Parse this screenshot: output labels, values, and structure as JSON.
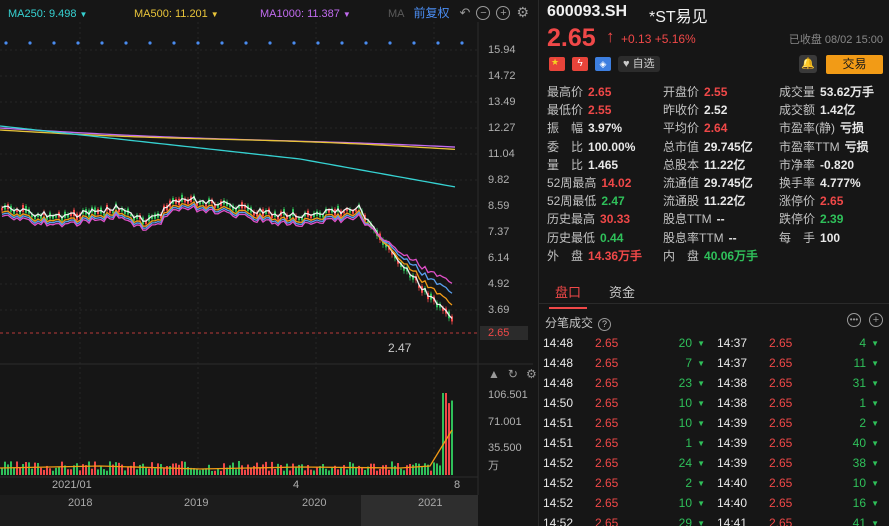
{
  "chart": {
    "ma": [
      {
        "label": "MA250: 9.498",
        "color": "#36d2d2"
      },
      {
        "label": "MA500: 11.201",
        "color": "#e8c43a"
      },
      {
        "label": "MA1000: 11.387",
        "color": "#c26cf0"
      },
      {
        "label": "MA",
        "color": "#5a5a5a"
      }
    ],
    "adjust_label": "前复权",
    "price_axis": [
      "15.94",
      "14.72",
      "13.49",
      "12.27",
      "11.04",
      "9.82",
      "8.59",
      "7.37",
      "6.14",
      "4.92",
      "3.69"
    ],
    "last_price_tag": "2.65",
    "low_label": "2.47",
    "volume_axis": [
      "106.501",
      "71.001",
      "35.500",
      "万"
    ],
    "dates": [
      "2021/01",
      "4",
      "8"
    ],
    "years": [
      "2018",
      "2019",
      "2020",
      "2021"
    ]
  },
  "quote": {
    "code": "600093.SH",
    "name": "*ST易见",
    "price": "2.65",
    "change": "+0.13 +5.16%",
    "status": "已收盘 08/02 15:00",
    "watch_label": "自选",
    "trade_label": "交易"
  },
  "stats": {
    "col1": [
      {
        "k": "最高价",
        "v": "2.65",
        "c": "red"
      },
      {
        "k": "最低价",
        "v": "2.55",
        "c": "red"
      },
      {
        "k": "振　幅",
        "v": "3.97%",
        "c": "white"
      },
      {
        "k": "委　比",
        "v": "100.00%",
        "c": "white"
      },
      {
        "k": "量　比",
        "v": "1.465",
        "c": "white"
      },
      {
        "k": "52周最高",
        "v": "14.02",
        "c": "red"
      },
      {
        "k": "52周最低",
        "v": "2.47",
        "c": "green"
      },
      {
        "k": "历史最高",
        "v": "30.33",
        "c": "red"
      },
      {
        "k": "历史最低",
        "v": "0.44",
        "c": "green"
      },
      {
        "k": "外　盘",
        "v": "14.36万手",
        "c": "red"
      }
    ],
    "col2": [
      {
        "k": "开盘价",
        "v": "2.55",
        "c": "red"
      },
      {
        "k": "昨收价",
        "v": "2.52",
        "c": "white"
      },
      {
        "k": "平均价",
        "v": "2.64",
        "c": "red"
      },
      {
        "k": "总市值",
        "v": "29.745亿",
        "c": "white"
      },
      {
        "k": "总股本",
        "v": "11.22亿",
        "c": "white"
      },
      {
        "k": "流通值",
        "v": "29.745亿",
        "c": "white"
      },
      {
        "k": "流通股",
        "v": "11.22亿",
        "c": "white"
      },
      {
        "k": "股息TTM",
        "v": "--",
        "c": "white"
      },
      {
        "k": "股息率TTM",
        "v": "--",
        "c": "white"
      },
      {
        "k": "内　盘",
        "v": "40.06万手",
        "c": "green"
      }
    ],
    "col3": [
      {
        "k": "成交量",
        "v": "53.62万手",
        "c": "white"
      },
      {
        "k": "成交额",
        "v": "1.42亿",
        "c": "white"
      },
      {
        "k": "市盈率(静)",
        "v": "亏损",
        "c": "white"
      },
      {
        "k": "市盈率TTM",
        "v": "亏损",
        "c": "white"
      },
      {
        "k": "市净率",
        "v": "-0.820",
        "c": "white"
      },
      {
        "k": "换手率",
        "v": "4.777%",
        "c": "white"
      },
      {
        "k": "涨停价",
        "v": "2.65",
        "c": "red"
      },
      {
        "k": "跌停价",
        "v": "2.39",
        "c": "green"
      },
      {
        "k": "每　手",
        "v": "100",
        "c": "white"
      }
    ]
  },
  "tabs": [
    "盘口",
    "资金"
  ],
  "ticks_title": "分笔成交",
  "ticks_left": [
    {
      "t": "14:48",
      "p": "2.65",
      "v": "20",
      "d": "down"
    },
    {
      "t": "14:48",
      "p": "2.65",
      "v": "7",
      "d": "down"
    },
    {
      "t": "14:48",
      "p": "2.65",
      "v": "23",
      "d": "down"
    },
    {
      "t": "14:50",
      "p": "2.65",
      "v": "10",
      "d": "down"
    },
    {
      "t": "14:51",
      "p": "2.65",
      "v": "10",
      "d": "down"
    },
    {
      "t": "14:51",
      "p": "2.65",
      "v": "1",
      "d": "down"
    },
    {
      "t": "14:52",
      "p": "2.65",
      "v": "24",
      "d": "down"
    },
    {
      "t": "14:52",
      "p": "2.65",
      "v": "2",
      "d": "down"
    },
    {
      "t": "14:52",
      "p": "2.65",
      "v": "10",
      "d": "down"
    },
    {
      "t": "14:52",
      "p": "2.65",
      "v": "29",
      "d": "down"
    }
  ],
  "ticks_right": [
    {
      "t": "14:37",
      "p": "2.65",
      "v": "4",
      "d": "down"
    },
    {
      "t": "14:37",
      "p": "2.65",
      "v": "11",
      "d": "down"
    },
    {
      "t": "14:38",
      "p": "2.65",
      "v": "31",
      "d": "down"
    },
    {
      "t": "14:38",
      "p": "2.65",
      "v": "1",
      "d": "down"
    },
    {
      "t": "14:39",
      "p": "2.65",
      "v": "2",
      "d": "down"
    },
    {
      "t": "14:39",
      "p": "2.65",
      "v": "40",
      "d": "down"
    },
    {
      "t": "14:39",
      "p": "2.65",
      "v": "38",
      "d": "down"
    },
    {
      "t": "14:40",
      "p": "2.65",
      "v": "10",
      "d": "down"
    },
    {
      "t": "14:40",
      "p": "2.65",
      "v": "16",
      "d": "down"
    },
    {
      "t": "14:41",
      "p": "2.65",
      "v": "41",
      "d": "down"
    }
  ]
}
